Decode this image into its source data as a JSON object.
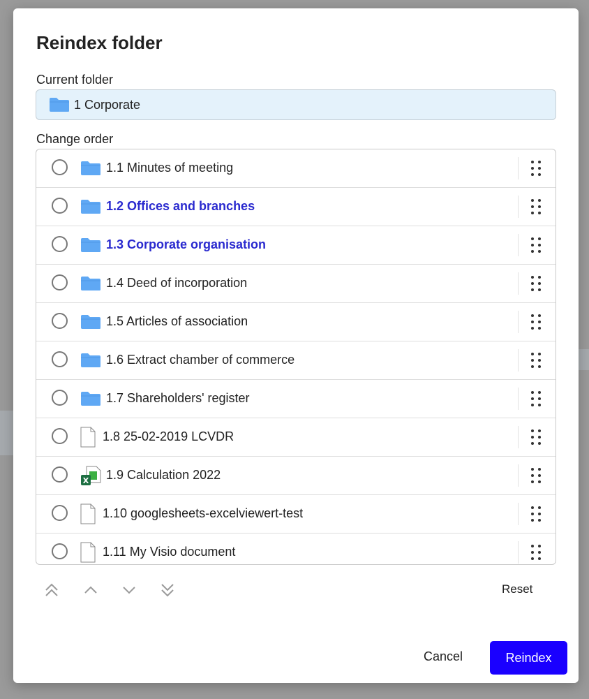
{
  "dialog": {
    "title": "Reindex folder",
    "current_folder_label": "Current folder",
    "current_folder": "1 Corporate",
    "change_order_label": "Change order",
    "items": [
      {
        "label": "1.1 Minutes of meeting",
        "type": "folder",
        "highlighted": false
      },
      {
        "label": "1.2 Offices and branches",
        "type": "folder",
        "highlighted": true
      },
      {
        "label": "1.3 Corporate organisation",
        "type": "folder",
        "highlighted": true
      },
      {
        "label": "1.4 Deed of incorporation",
        "type": "folder",
        "highlighted": false
      },
      {
        "label": "1.5 Articles of association",
        "type": "folder",
        "highlighted": false
      },
      {
        "label": "1.6 Extract chamber of commerce",
        "type": "folder",
        "highlighted": false
      },
      {
        "label": "1.7 Shareholders' register",
        "type": "folder",
        "highlighted": false
      },
      {
        "label": "1.8 25-02-2019 LCVDR",
        "type": "document",
        "highlighted": false
      },
      {
        "label": "1.9 Calculation 2022",
        "type": "excel",
        "highlighted": false
      },
      {
        "label": "1.10 googlesheets-excelviewert-test",
        "type": "document",
        "highlighted": false
      },
      {
        "label": "1.11 My Visio document",
        "type": "document",
        "highlighted": false
      }
    ],
    "reset_label": "Reset",
    "cancel_label": "Cancel",
    "reindex_label": "Reindex"
  },
  "colors": {
    "accent": "#1a00ff",
    "highlight_text": "#2a2acf",
    "folder": "#5fa8f4",
    "current_folder_bg": "#e4f2fb"
  },
  "icons": {
    "move_top": "double-chevron-up-icon",
    "move_up": "chevron-up-icon",
    "move_down": "chevron-down-icon",
    "move_bottom": "double-chevron-down-icon",
    "drag": "drag-handle-icon"
  }
}
